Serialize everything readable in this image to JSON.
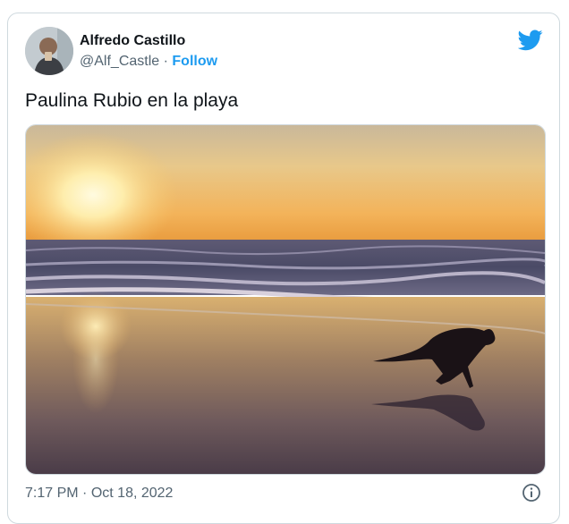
{
  "author": {
    "display_name": "Alfredo Castillo",
    "handle": "@Alf_Castle",
    "separator": "·",
    "follow_label": "Follow"
  },
  "tweet": {
    "text": "Paulina Rubio en la playa",
    "time": "7:17 PM",
    "date": "Oct 18, 2022",
    "meta_separator": "·"
  },
  "icons": {
    "brand": "twitter-bird-icon",
    "info": "info-icon"
  },
  "colors": {
    "brand_blue": "#1d9bf0",
    "secondary_text": "#536471",
    "border": "#cfd9de"
  }
}
